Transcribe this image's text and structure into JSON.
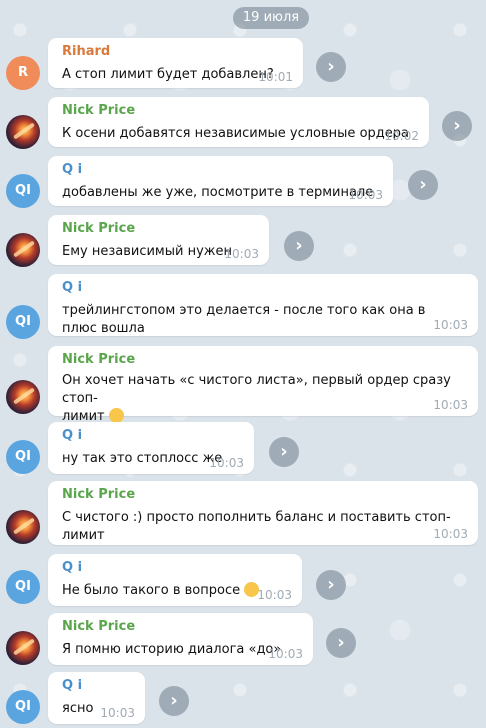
{
  "date_label": "19 июля",
  "messages": [
    {
      "avatar": "R",
      "sender": "Rihard",
      "text": "А стоп лимит будет добавлен?",
      "time": "10:01"
    },
    {
      "avatar": "",
      "sender": "Nick Price",
      "text": "К осени добавятся независимые условные ордера",
      "time": "10:02"
    },
    {
      "avatar": "QI",
      "sender": "Q i",
      "text": "добавлены же уже, посмотрите в терминале",
      "time": "10:03"
    },
    {
      "avatar": "",
      "sender": "Nick Price",
      "text": "Ему независимый нужен",
      "time": "10:03"
    },
    {
      "avatar": "QI",
      "sender": "Q i",
      "text": "трейлингстопом это делается - после того как она в плюс вошла",
      "time": "10:03"
    },
    {
      "avatar": "",
      "sender": "Nick Price",
      "text_line1": "Он хочет начать «с чистого листа», первый ордер сразу стоп-",
      "text_line2": "лимит",
      "time": "10:03"
    },
    {
      "avatar": "QI",
      "sender": "Q i",
      "text": "ну так это стоплосс же",
      "time": "10:03"
    },
    {
      "avatar": "",
      "sender": "Nick Price",
      "text": "С чистого :)  просто пополнить баланс и поставить стоп-лимит",
      "time": "10:03"
    },
    {
      "avatar": "QI",
      "sender": "Q i",
      "text": "Не было такого в вопросе",
      "time": "10:03"
    },
    {
      "avatar": "",
      "sender": "Nick Price",
      "text": "Я помню историю диалога «до»",
      "time": "10:03"
    },
    {
      "avatar": "QI",
      "sender": "Q i",
      "text": "ясно",
      "time": "10:03"
    }
  ],
  "share_icon": "›"
}
